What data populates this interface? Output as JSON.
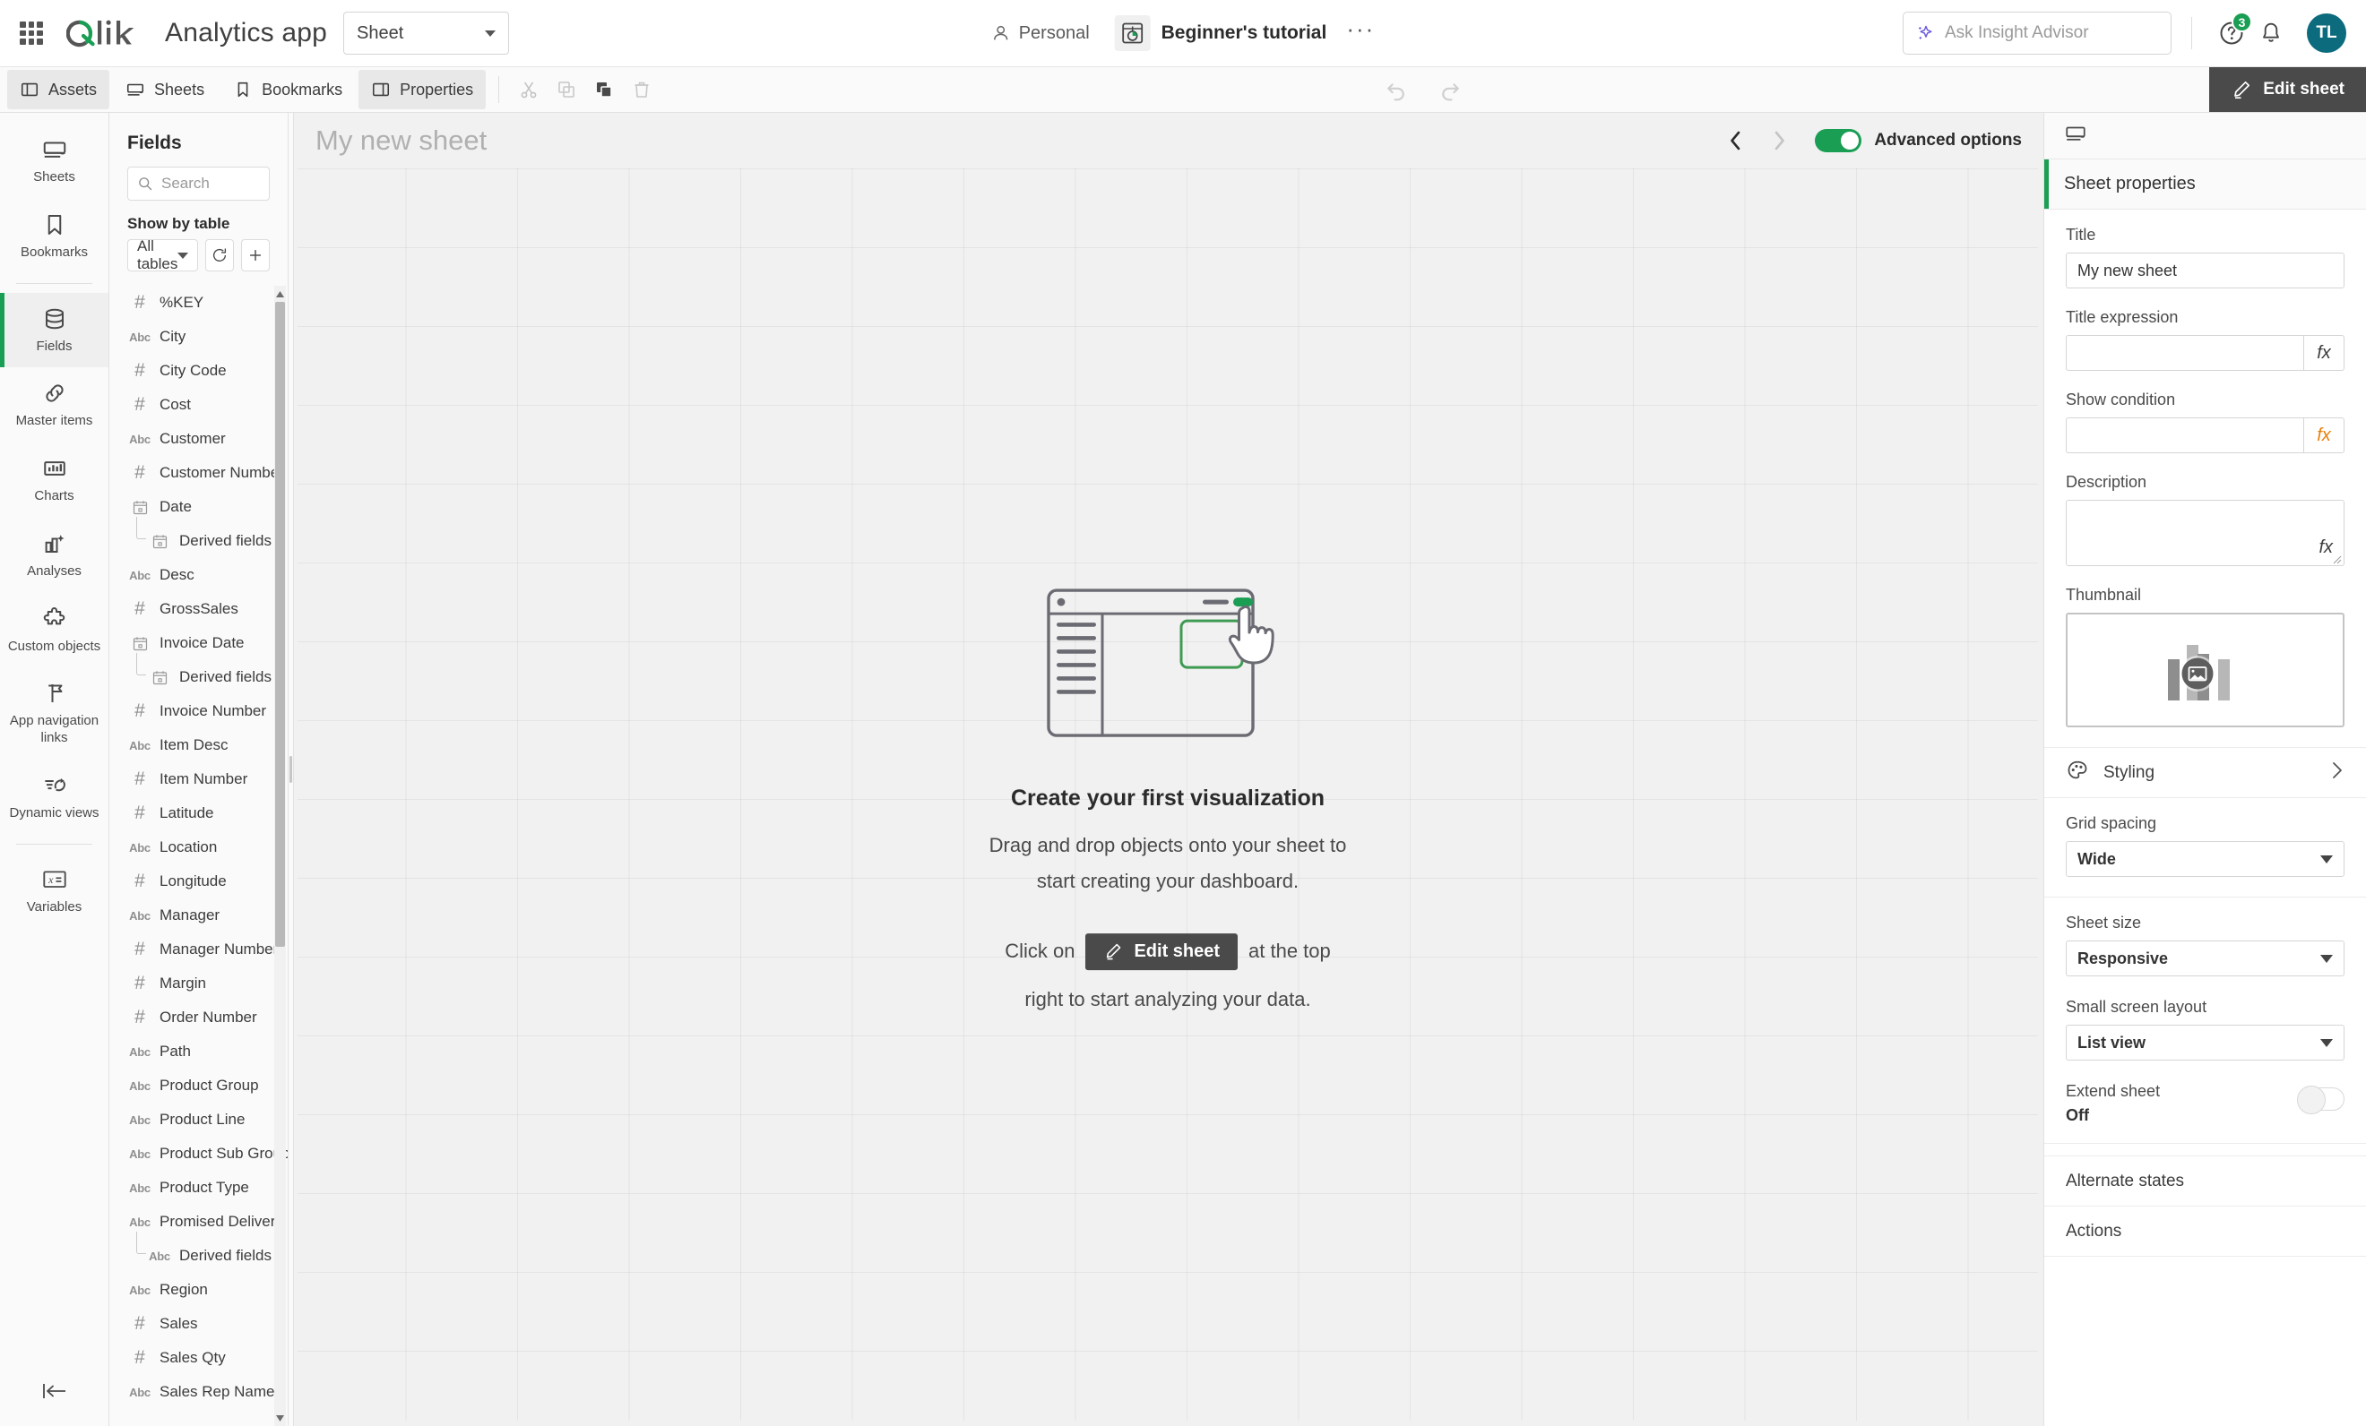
{
  "topbar": {
    "grid_icon": "app-launcher-icon",
    "logo_text": "Qlik",
    "app_title": "Analytics app",
    "sheet_select": {
      "value": "Sheet"
    },
    "space": {
      "label": "Personal",
      "icon": "person-icon"
    },
    "app_chip": {
      "icon": "app-icon",
      "name": "Beginner's tutorial"
    },
    "more_menu": "···",
    "insight": {
      "placeholder": "Ask Insight Advisor",
      "icon": "sparkle-icon"
    },
    "help": {
      "icon": "help-icon",
      "badge": "3"
    },
    "notifications": {
      "icon": "bell-icon"
    },
    "avatar": {
      "initials": "TL",
      "color": "#0c6b7d"
    }
  },
  "toolbar": {
    "items": [
      {
        "label": "Assets",
        "icon": "panel-left-icon",
        "active": true
      },
      {
        "label": "Sheets",
        "icon": "sheet-icon",
        "active": false
      },
      {
        "label": "Bookmarks",
        "icon": "bookmark-icon",
        "active": false
      },
      {
        "label": "Properties",
        "icon": "panel-right-icon",
        "active": true
      }
    ],
    "edit_icons": [
      "cut-icon",
      "copy-icon",
      "paste-icon",
      "delete-icon"
    ],
    "undo": "undo-icon",
    "redo": "redo-icon",
    "edit_sheet_label": "Edit sheet"
  },
  "rail": {
    "items": [
      {
        "label": "Sheets",
        "icon": "sheet-icon",
        "active": false
      },
      {
        "label": "Bookmarks",
        "icon": "bookmark-icon",
        "active": false
      },
      {
        "label": "Fields",
        "icon": "database-icon",
        "active": true
      },
      {
        "label": "Master items",
        "icon": "link-icon",
        "active": false
      },
      {
        "label": "Charts",
        "icon": "bar-chart-icon",
        "active": false
      },
      {
        "label": "Analyses",
        "icon": "analyses-icon",
        "active": false
      },
      {
        "label": "Custom objects",
        "icon": "puzzle-icon",
        "active": false
      },
      {
        "label": "App navigation links",
        "icon": "flag-icon",
        "active": false
      },
      {
        "label": "Dynamic views",
        "icon": "dynamic-views-icon",
        "active": false
      },
      {
        "label": "Variables",
        "icon": "variable-icon",
        "active": false
      }
    ],
    "collapse_icon": "collapse-left-icon"
  },
  "assets": {
    "title": "Fields",
    "search_placeholder": "Search",
    "show_by_table_label": "Show by table",
    "table_filter": "All tables",
    "refresh_icon": "refresh-icon",
    "add_icon": "plus-icon",
    "fields": [
      {
        "name": "%KEY",
        "type": "num"
      },
      {
        "name": "City",
        "type": "abc"
      },
      {
        "name": "City Code",
        "type": "num"
      },
      {
        "name": "Cost",
        "type": "num"
      },
      {
        "name": "Customer",
        "type": "abc"
      },
      {
        "name": "Customer Number",
        "type": "num"
      },
      {
        "name": "Date",
        "type": "date"
      },
      {
        "name": "Derived fields",
        "type": "date",
        "derived": true
      },
      {
        "name": "Desc",
        "type": "abc"
      },
      {
        "name": "GrossSales",
        "type": "num"
      },
      {
        "name": "Invoice Date",
        "type": "date"
      },
      {
        "name": "Derived fields",
        "type": "date",
        "derived": true
      },
      {
        "name": "Invoice Number",
        "type": "num"
      },
      {
        "name": "Item Desc",
        "type": "abc"
      },
      {
        "name": "Item Number",
        "type": "num"
      },
      {
        "name": "Latitude",
        "type": "num"
      },
      {
        "name": "Location",
        "type": "abc"
      },
      {
        "name": "Longitude",
        "type": "num"
      },
      {
        "name": "Manager",
        "type": "abc"
      },
      {
        "name": "Manager Number",
        "type": "num"
      },
      {
        "name": "Margin",
        "type": "num"
      },
      {
        "name": "Order Number",
        "type": "num"
      },
      {
        "name": "Path",
        "type": "abc"
      },
      {
        "name": "Product Group",
        "type": "abc"
      },
      {
        "name": "Product Line",
        "type": "abc"
      },
      {
        "name": "Product Sub Group",
        "type": "abc"
      },
      {
        "name": "Product Type",
        "type": "abc"
      },
      {
        "name": "Promised Delivery Date",
        "type": "abc"
      },
      {
        "name": "Derived fields",
        "type": "abc",
        "derived": true
      },
      {
        "name": "Region",
        "type": "abc"
      },
      {
        "name": "Sales",
        "type": "num"
      },
      {
        "name": "Sales Qty",
        "type": "num"
      },
      {
        "name": "Sales Rep Name",
        "type": "abc"
      }
    ]
  },
  "canvas": {
    "sheet_heading": "My new sheet",
    "prev_icon": "chevron-left-icon",
    "next_icon": "chevron-right-icon",
    "advanced_options": {
      "label": "Advanced options",
      "state": "on"
    },
    "empty_state": {
      "illustration": "drag-drop-illustration",
      "title": "Create your first visualization",
      "line1": "Drag and drop objects onto your sheet to",
      "line2": "start creating your dashboard.",
      "cta_prefix": "Click on",
      "cta_button": "Edit sheet",
      "cta_suffix": "at the top",
      "cta_line2": "right to start analyzing your data."
    }
  },
  "properties": {
    "tab_icon": "sheet-icon",
    "section_title": "Sheet properties",
    "title_label": "Title",
    "title_value": "My new sheet",
    "title_expression_label": "Title expression",
    "title_expression_value": "",
    "show_condition_label": "Show condition",
    "show_condition_value": "",
    "description_label": "Description",
    "description_value": "",
    "thumbnail_label": "Thumbnail",
    "thumbnail_icon": "image-placeholder-icon",
    "styling_label": "Styling",
    "styling_icon": "palette-icon",
    "grid_spacing_label": "Grid spacing",
    "grid_spacing_value": "Wide",
    "sheet_size_label": "Sheet size",
    "sheet_size_value": "Responsive",
    "small_screen_label": "Small screen layout",
    "small_screen_value": "List view",
    "extend_sheet_label": "Extend sheet",
    "extend_sheet_state": "Off",
    "alternate_states_label": "Alternate states",
    "actions_label": "Actions",
    "fx_label": "fx"
  }
}
